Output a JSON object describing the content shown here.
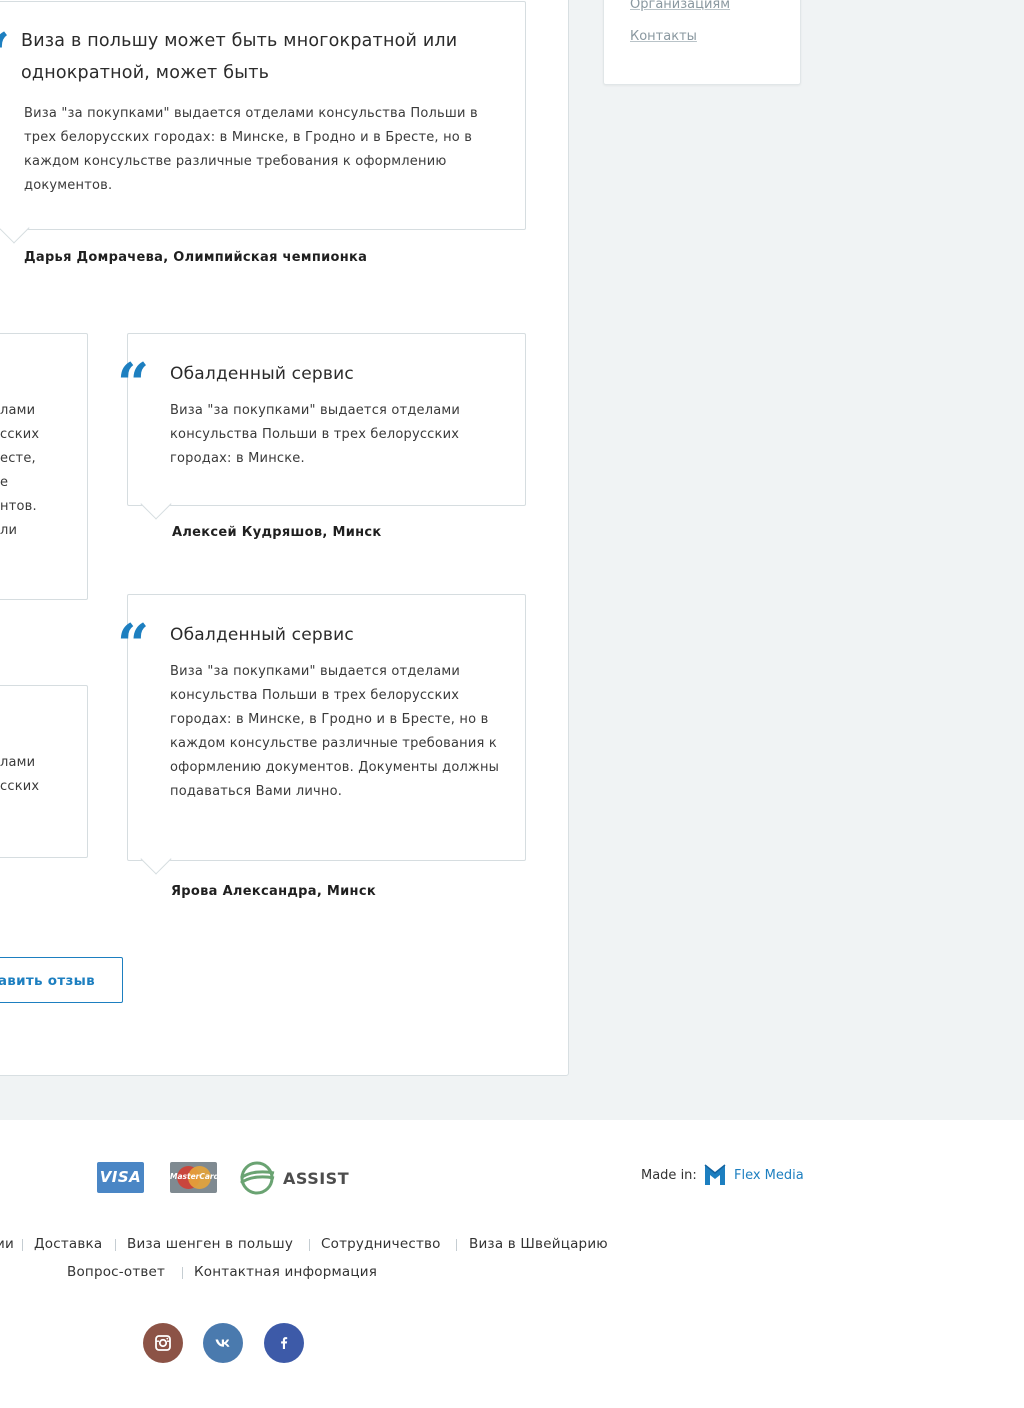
{
  "sidebar": {
    "links": [
      {
        "label": "Организациям"
      },
      {
        "label": "Контакты"
      }
    ]
  },
  "featured_review": {
    "title": "Виза в польшу может быть многократной или однократной, может быть",
    "text": "Виза \"за покупками\" выдается отделами консульства Польши в трех белорусских городах: в Минске, в Гродно и в Бресте, но в каждом консульстве различные требования к оформлению документов.",
    "author": "Дарья Домрачева, Олимпийская чемпионка"
  },
  "left_fragments": {
    "card1_lines": [
      "лами",
      "сских",
      "есте,",
      "е",
      "нтов.",
      "ли"
    ],
    "card2_lines": [
      "лами",
      "сских"
    ]
  },
  "reviews": [
    {
      "title": "Обалденный сервис",
      "text": "Виза \"за покупками\" выдается отделами консульства Польши в трех белорусских городах: в Минске.",
      "author": "Алексей Кудряшов, Минск"
    },
    {
      "title": "Обалденный сервис",
      "text": "Виза \"за покупками\" выдается отделами консульства Польши в трех белорусских городах: в Минске, в Гродно и в Бресте, но в каждом консульстве различные требования к оформлению документов. Документы должны подаваться Вами лично.",
      "author": "Ярова Александра, Минск"
    }
  ],
  "leave_review_button": "авить отзыв",
  "footer": {
    "payments": {
      "visa": "VISA",
      "mastercard": "MasterCard",
      "assist": "ASSIST"
    },
    "made_in_label": "Made in:",
    "made_in_company": "Flex Media",
    "nav_row1": [
      "ии",
      "Доставка",
      "Виза шенген в польшу",
      "Сотрудничество",
      "Виза в Швейцарию"
    ],
    "nav_row2": [
      "Вопрос-ответ",
      "Контактная информация"
    ],
    "social": [
      {
        "icon": "instagram-icon",
        "color": "#8c5346"
      },
      {
        "icon": "vk-icon",
        "color": "#4a7aae"
      },
      {
        "icon": "facebook-icon",
        "color": "#3d5aa8"
      }
    ]
  },
  "colors": {
    "accent": "#1d7fc0",
    "page_bg": "#f0f3f4",
    "card_border": "#d6dde0"
  }
}
